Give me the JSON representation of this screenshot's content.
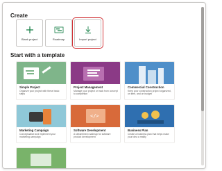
{
  "sections": {
    "create_title": "Create",
    "templates_title": "Start with a template"
  },
  "create_cards": [
    {
      "label": "Blank project",
      "icon": "plus-icon"
    },
    {
      "label": "Roadmap",
      "icon": "roadmap-icon"
    },
    {
      "label": "Import project",
      "icon": "download-icon",
      "highlighted": true
    }
  ],
  "templates": [
    {
      "name": "Simple Project",
      "desc": "Organize your project with these basic steps",
      "icon": "chart-illustration",
      "color": "#7fb58a"
    },
    {
      "name": "Project Management",
      "desc": "Manage your project or track from concept to completion",
      "icon": "document-illustration",
      "color": "#8b3a86"
    },
    {
      "name": "Commercial Construction",
      "desc": "Keep your construction project organized, on time, and on budget",
      "icon": "building-illustration",
      "color": "#4f8fc9"
    },
    {
      "name": "Marketing Campaign",
      "desc": "Conceptualize and implement your marketing campaign",
      "icon": "megaphone-illustration",
      "color": "#8fc8d8"
    },
    {
      "name": "Software Development",
      "desc": "A streamlined roadmap for software product development",
      "icon": "code-illustration",
      "color": "#d86a3a"
    },
    {
      "name": "Business Plan",
      "desc": "Create a business plan that helps make your idea a reality",
      "icon": "coins-illustration",
      "color": "#2f6fb0"
    },
    {
      "name": "",
      "desc": "",
      "icon": "template-illustration",
      "color": "#79b36a"
    }
  ],
  "colors": {
    "accent": "#107c41",
    "highlight": "#d13438"
  }
}
